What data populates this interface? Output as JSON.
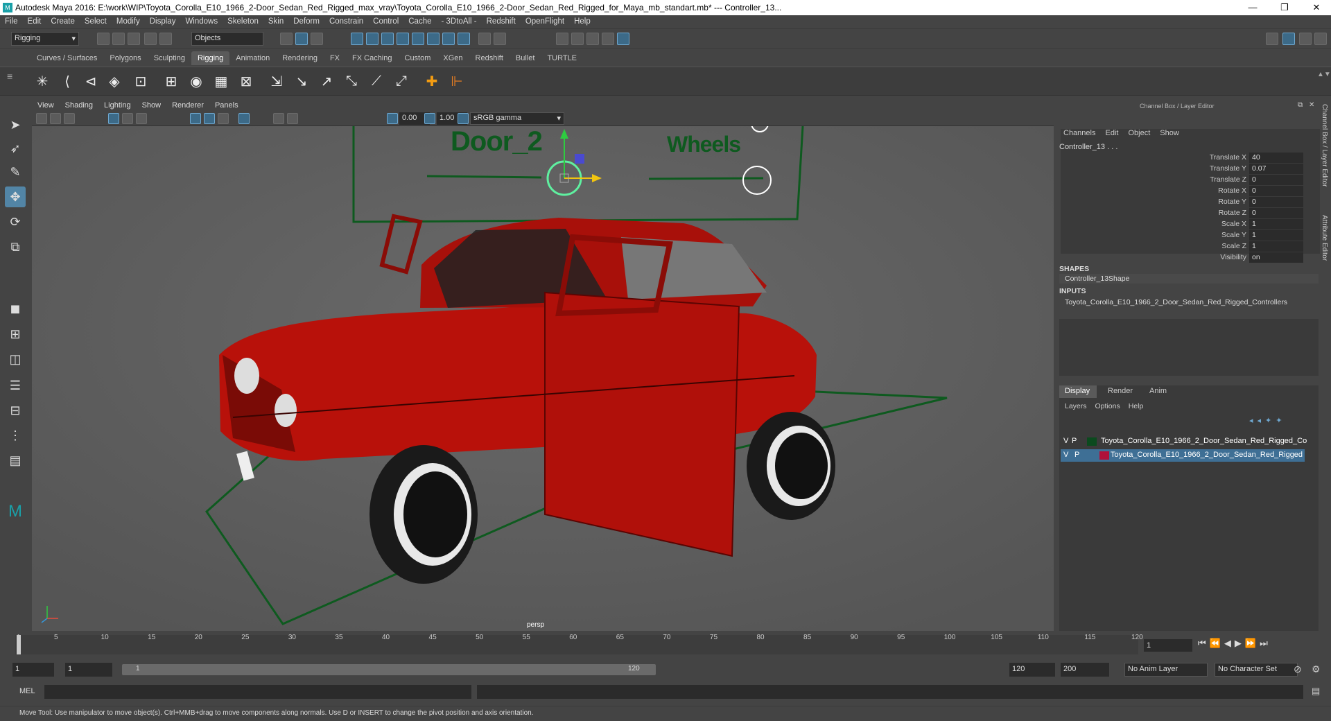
{
  "title_bar": {
    "logo": "M",
    "title": "Autodesk Maya 2016: E:\\work\\WIP\\Toyota_Corolla_E10_1966_2-Door_Sedan_Red_Rigged_max_vray\\Toyota_Corolla_E10_1966_2-Door_Sedan_Red_Rigged_for_Maya_mb_standart.mb*   ---   Controller_13...",
    "minimize": "—",
    "maximize": "❐",
    "close": "✕"
  },
  "menu": [
    "File",
    "Edit",
    "Create",
    "Select",
    "Modify",
    "Display",
    "Windows",
    "Skeleton",
    "Skin",
    "Deform",
    "Constrain",
    "Control",
    "Cache",
    "- 3DtoAll -",
    "Redshift",
    "OpenFlight",
    "Help"
  ],
  "status_line": {
    "mode": "Rigging",
    "select_mode": "Objects"
  },
  "shelf_tabs": [
    "Curves / Surfaces",
    "Polygons",
    "Sculpting",
    "Rigging",
    "Animation",
    "Rendering",
    "FX",
    "FX Caching",
    "Custom",
    "XGen",
    "Redshift",
    "Bullet",
    "TURTLE"
  ],
  "active_shelf": "Rigging",
  "viewport": {
    "menu": [
      "View",
      "Shading",
      "Lighting",
      "Show",
      "Renderer",
      "Panels"
    ],
    "near_value": "0.00",
    "far_value": "1.00",
    "color_space": "sRGB gamma",
    "camera_label": "persp",
    "controller_labels": {
      "door": "Door_2",
      "wheels": "Wheels"
    }
  },
  "channel_box": {
    "header": "Channel Box / Layer Editor",
    "menu": [
      "Channels",
      "Edit",
      "Object",
      "Show"
    ],
    "object_name": "Controller_13 . . .",
    "channels": [
      {
        "name": "Translate X",
        "value": "40"
      },
      {
        "name": "Translate Y",
        "value": "0.07"
      },
      {
        "name": "Translate Z",
        "value": "0"
      },
      {
        "name": "Rotate X",
        "value": "0"
      },
      {
        "name": "Rotate Y",
        "value": "0"
      },
      {
        "name": "Rotate Z",
        "value": "0"
      },
      {
        "name": "Scale X",
        "value": "1"
      },
      {
        "name": "Scale Y",
        "value": "1"
      },
      {
        "name": "Scale Z",
        "value": "1"
      },
      {
        "name": "Visibility",
        "value": "on"
      }
    ],
    "shapes_header": "SHAPES",
    "shape": "Controller_13Shape",
    "inputs_header": "INPUTS",
    "input": "Toyota_Corolla_E10_1966_2_Door_Sedan_Red_Rigged_Controllers"
  },
  "side_tabs": {
    "channel_box": "Channel Box / Layer Editor",
    "attribute_editor": "Attribute Editor"
  },
  "layer_editor": {
    "tabs": [
      "Display",
      "Render",
      "Anim"
    ],
    "active_tab": "Display",
    "menu": [
      "Layers",
      "Options",
      "Help"
    ],
    "layers": [
      {
        "v": "V",
        "p": "P",
        "color": "#0b4a1e",
        "name": "Toyota_Corolla_E10_1966_2_Door_Sedan_Red_Rigged_Co"
      },
      {
        "v": "V",
        "p": "P",
        "color": "#b0103a",
        "name": "Toyota_Corolla_E10_1966_2_Door_Sedan_Red_Rigged"
      }
    ]
  },
  "time_slider": {
    "ticks": [
      "1",
      "5",
      "10",
      "15",
      "20",
      "25",
      "30",
      "35",
      "40",
      "45",
      "50",
      "55",
      "60",
      "65",
      "70",
      "75",
      "80",
      "85",
      "90",
      "95",
      "100",
      "105",
      "110",
      "115",
      "120"
    ],
    "current_frame": "1"
  },
  "range_slider": {
    "start": "1",
    "range_start": "1",
    "slider_start": "1",
    "slider_end": "120",
    "range_end": "120",
    "end": "200",
    "anim_layer": "No Anim Layer",
    "character_set": "No Character Set"
  },
  "command_line": {
    "label": "MEL"
  },
  "help_line": "Move Tool: Use manipulator to move object(s). Ctrl+MMB+drag to move components along normals. Use D or INSERT to change the pivot position and axis orientation."
}
